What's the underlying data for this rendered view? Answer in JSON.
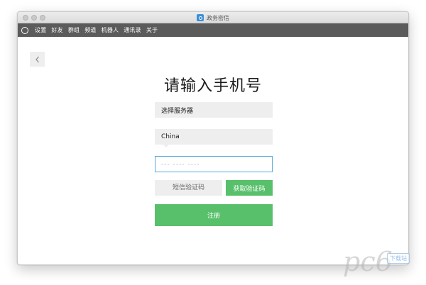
{
  "window": {
    "title": "政务密信",
    "app_icon": "app-logo-icon"
  },
  "menubar": {
    "logo_icon": "app-ring-logo-icon",
    "items": [
      "设置",
      "好友",
      "群组",
      "频道",
      "机器人",
      "通讯录",
      "关于"
    ]
  },
  "back_button": {
    "icon": "chevron-left-icon"
  },
  "page": {
    "title": "请输入手机号"
  },
  "form": {
    "server_select": {
      "label": "选择服务器"
    },
    "country_select": {
      "value": "China"
    },
    "phone_input": {
      "placeholder": "--- ---- ----",
      "value": ""
    },
    "code_input": {
      "placeholder": "短信验证码",
      "value": ""
    },
    "get_code_button": {
      "label": "获取验证码"
    },
    "register_button": {
      "label": "注册"
    }
  },
  "watermark": {
    "brand": "pc6",
    "tag": "下载站"
  },
  "colors": {
    "accent_green": "#58c06b",
    "menubar_bg": "#5b5b5b",
    "input_focus_border": "#58a8de",
    "field_bg": "#eeeeee"
  }
}
